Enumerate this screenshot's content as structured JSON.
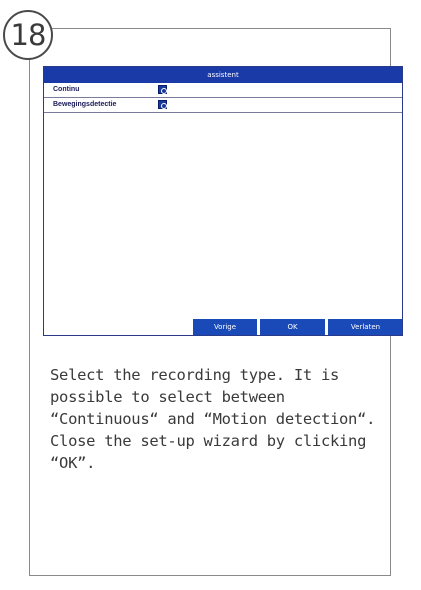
{
  "step": {
    "number": "18"
  },
  "screen": {
    "title": "assistent",
    "options": [
      {
        "label": "Continu",
        "checked": true
      },
      {
        "label": "Bewegingsdetectie",
        "checked": true
      }
    ],
    "buttons": {
      "prev": "Vorige",
      "ok": "OK",
      "exit": "Verlaten"
    }
  },
  "caption": {
    "text": "Select the recording type. It is possible to select between “Continuous“ and “Motion detection“. Close the set-up wizard by clicking “OK”."
  },
  "colors": {
    "title_bar": "#1a3aa8",
    "button": "#1a4ab8",
    "caption_text": "#3a3a3a",
    "card_border": "#8a8a8a"
  }
}
